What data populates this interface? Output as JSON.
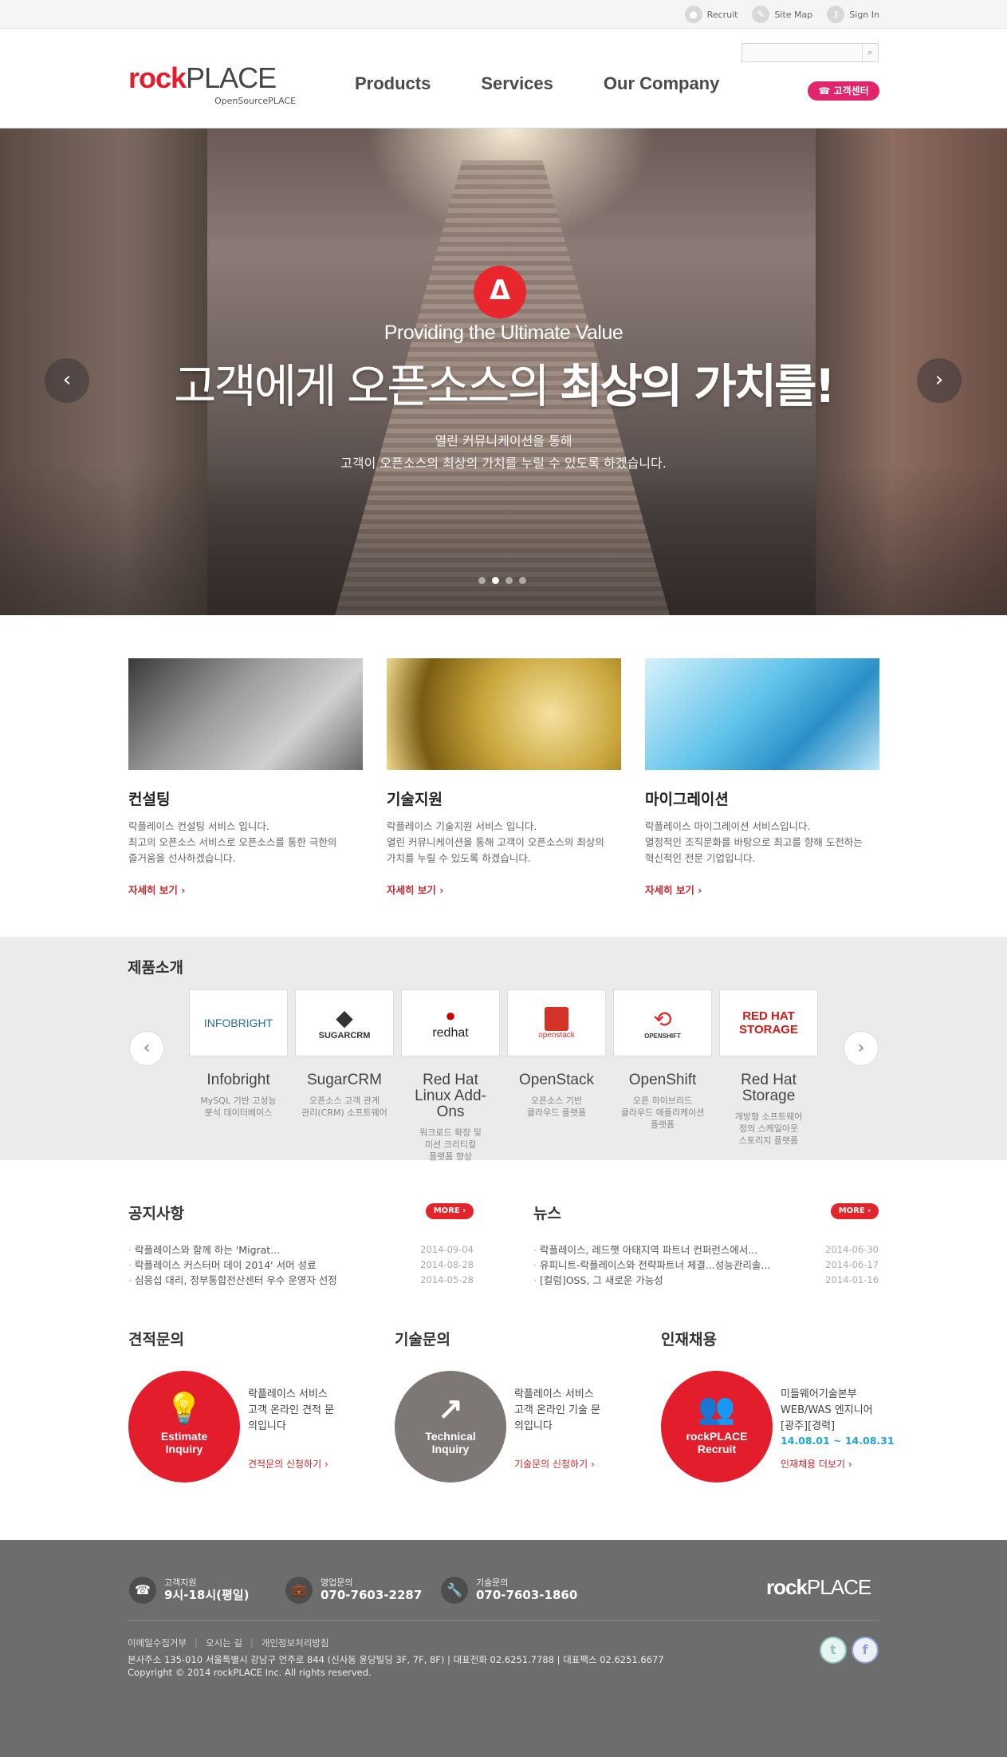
{
  "topbar": {
    "links": [
      {
        "label": "Recruit",
        "icon": "person-icon"
      },
      {
        "label": "Site Map",
        "icon": "sitemap-icon"
      },
      {
        "label": "Sign In",
        "icon": "key-icon"
      }
    ]
  },
  "header": {
    "logo_bold": "rock",
    "logo_light": "PLACE",
    "logo_sub": "OpenSourcePLACE",
    "nav": [
      "Products",
      "Services",
      "Our Company"
    ],
    "search_placeholder": "",
    "cs_button": "☎ 고객센터"
  },
  "hero": {
    "icon": "Δ",
    "subtitle": "Providing the Ultimate Value",
    "title_light": "고객에게 오픈소스의",
    "title_bold": "최상의 가치를!",
    "desc_line1": "열린 커뮤니케이션을 통해",
    "desc_line2": "고객이 오픈소스의 최상의 가치를 누릴 수 있도록 하겠습니다.",
    "prev": "‹",
    "next": "›",
    "slide_count": 4,
    "active_slide": 2
  },
  "services": [
    {
      "title": "컨설팅",
      "desc": "락플레이스 컨설팅 서비스 입니다.\n최고의 오픈소스 서비스로 오픈소스를 통한 극한의\n즐거움을 선사하겠습니다.",
      "more": "자세히 보기 ›"
    },
    {
      "title": "기술지원",
      "desc": "락플레이스 기술지원 서비스 입니다.\n열린 커뮤니케이션을 통해 고객이 오픈소스의 최상의\n가치를 누릴 수 있도록 하겠습니다.",
      "more": "자세히 보기 ›"
    },
    {
      "title": "마이그레이션",
      "desc": "락플레이스 마이그레이션 서비스입니다.\n열정적인 조직문화를 바탕으로 최고를 향해 도전하는\n혁신적인 전문 기업입니다.",
      "more": "자세히 보기 ›"
    }
  ],
  "products": {
    "title": "제품소개",
    "prev": "‹",
    "next": "›",
    "items": [
      {
        "logo": "INFOBRIGHT",
        "name": "Infobright",
        "desc": "MySQL 기반 고성능\n분석 데이터베이스"
      },
      {
        "logo": "SUGARCRM",
        "name": "SugarCRM",
        "desc": "오픈소스 고객 관계\n관리(CRM) 소프트웨어"
      },
      {
        "logo": "redhat",
        "name": "Red Hat\nLinux Add-Ons",
        "desc": "워크로드 확장 및\n미션 크리티컬\n플랫폼 향상"
      },
      {
        "logo": "openstack",
        "name": "OpenStack",
        "desc": "오픈소스 기반\n클라우드 플랫폼"
      },
      {
        "logo": "OPENSHIFT",
        "name": "OpenShift",
        "desc": "오픈 하이브리드\n클라우드 애플리케이션\n플랫폼"
      },
      {
        "logo": "RED HAT STORAGE",
        "name": "Red Hat\nStorage",
        "desc": "개방형 소프트웨어\n정의 스케일아웃\n스토리지 플랫폼"
      }
    ]
  },
  "notice": {
    "title": "공지사항",
    "more": "MORE ›",
    "items": [
      {
        "text": "락플레이스와 함께 하는 'Migrat...",
        "date": "2014-09-04"
      },
      {
        "text": "락플레이스 커스터머 데이 2014' 서머 성료",
        "date": "2014-08-28"
      },
      {
        "text": "심응섭 대리, 정부통합전산센터 우수 운영자 선정",
        "date": "2014-05-28"
      }
    ]
  },
  "news": {
    "title": "뉴스",
    "more": "MORE ›",
    "items": [
      {
        "text": "락플레이스, 레드햇 아태지역 파트너 컨퍼런스에서...",
        "date": "2014-06-30"
      },
      {
        "text": "유피니트-락플레이스와 전략파트너 체결...성능관리솔...",
        "date": "2014-06-17"
      },
      {
        "text": "[컬럼]OSS, 그 새로운 가능성",
        "date": "2014-01-16"
      }
    ]
  },
  "inquiries": [
    {
      "title": "견적문의",
      "icon": "lightbulb-icon",
      "glyph": "💡",
      "circle": "Estimate\nInquiry",
      "text": "락플레이스 서비스\n고객 온라인 견적 문\n의입니다",
      "link": "견적문의 신청하기 ›",
      "color": "#e31d2c"
    },
    {
      "title": "기술문의",
      "icon": "chart-icon",
      "glyph": "↗",
      "circle": "Technical\nInquiry",
      "text": "락플레이스 서비스\n고객 온라인 기술 문\n의입니다",
      "link": "기술문의 신청하기 ›",
      "color": "#7d7775"
    },
    {
      "title": "인재채용",
      "icon": "people-icon",
      "glyph": "👥",
      "circle": "rockPLACE\nRecruit",
      "text": "미들웨어기술본부\nWEB/WAS 엔지니어\n[광주][경력]",
      "period": "14.08.01 ~ 14.08.31",
      "link": "인재채용 더보기 ›",
      "color": "#e31d2c"
    }
  ],
  "footer": {
    "contacts": [
      {
        "label": "고객지원",
        "value": "9시-18시(평일)",
        "icon": "headset-icon",
        "glyph": "☎"
      },
      {
        "label": "영업문의",
        "value": "070-7603-2287",
        "icon": "briefcase-icon",
        "glyph": "💼"
      },
      {
        "label": "기술문의",
        "value": "070-7603-1860",
        "icon": "wrench-icon",
        "glyph": "🔧"
      }
    ],
    "logo_bold": "rock",
    "logo_light": "PLACE",
    "links": [
      "이메일수집거부",
      "오시는 길",
      "개인정보처리방침"
    ],
    "address": "본사주소 135-010 서울특별시 강남구 언주로 844 (신사동 윤당빌딩 3F, 7F, 8F)  |  대표전화 02.6251.7788  |  대표팩스 02.6251.6677",
    "copyright": "Copyright © 2014 rockPLACE Inc. All rights reserved.",
    "twitter": "t",
    "facebook": "f"
  },
  "colors": {
    "brand_red": "#e31d2c",
    "cs_pink": "#e0256d",
    "link_red": "#c9282d",
    "footer_bg": "#6d6d6d",
    "product_bg": "#ebebeb",
    "period_blue": "#1ea4d6"
  }
}
